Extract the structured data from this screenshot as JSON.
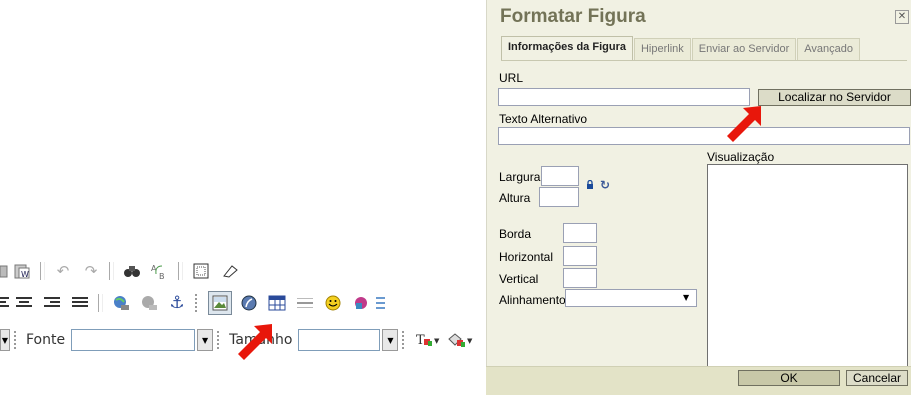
{
  "toolbar": {
    "font_label": "Fonte",
    "size_label": "Tamanho",
    "row1_icons": [
      "paste-icon",
      "paste-word-icon",
      "undo-icon",
      "redo-icon",
      "find-icon",
      "replace-icon",
      "select-all-icon",
      "remove-format-icon"
    ],
    "row2_icons": [
      "align-left-icon",
      "align-center-icon",
      "align-right-icon",
      "align-justify-icon",
      "link-icon",
      "unlink-icon",
      "anchor-icon",
      "image-icon",
      "flash-icon",
      "table-icon",
      "horizontal-rule-icon",
      "smiley-icon",
      "special-char-icon"
    ]
  },
  "dialog": {
    "title": "Formatar Figura",
    "tabs": [
      "Informações da Figura",
      "Hiperlink",
      "Enviar ao Servidor",
      "Avançado"
    ],
    "url_label": "URL",
    "url_value": "",
    "browse_button": "Localizar no Servidor",
    "alt_label": "Texto Alternativo",
    "alt_value": "",
    "width_label": "Largura",
    "height_label": "Altura",
    "border_label": "Borda",
    "hspace_label": "Horizontal",
    "vspace_label": "Vertical",
    "align_label": "Alinhamento",
    "align_value": "",
    "preview_label": "Visualização",
    "ok_button": "OK",
    "cancel_button": "Cancelar"
  },
  "colors": {
    "dialog_bg": "#f1f1e3",
    "title": "#737357",
    "arrow": "#e8170b"
  }
}
